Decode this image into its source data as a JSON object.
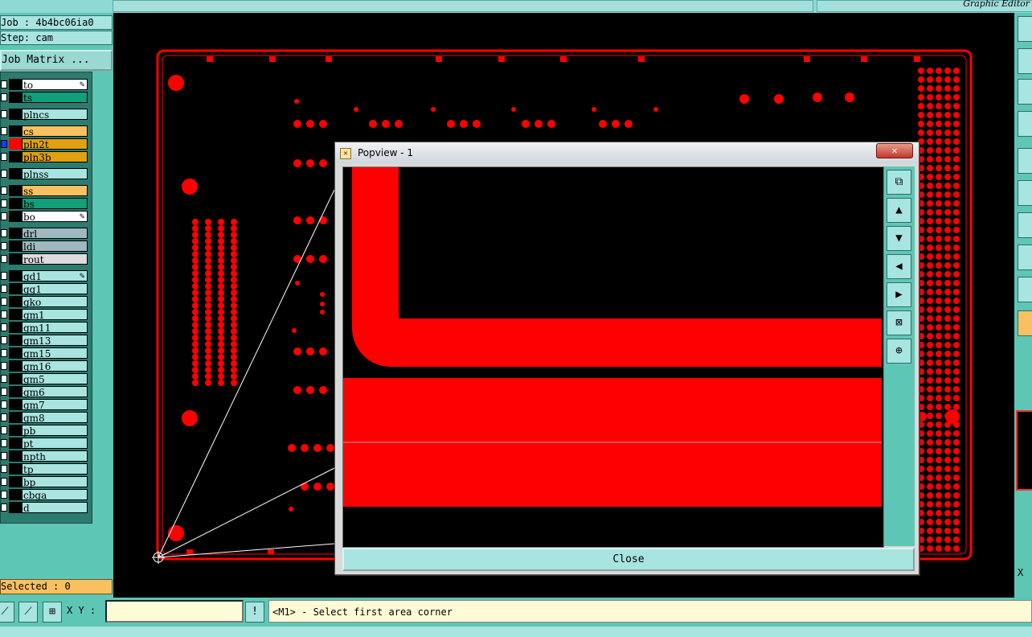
{
  "window_title": "Graphic Editor",
  "job": "Job : 4b4bc06ia0",
  "step": "Step: cam",
  "job_matrix_button": "Job Matrix ...",
  "layers": [
    {
      "name": "to",
      "color": "#ffffff",
      "pen": true
    },
    {
      "name": "ts",
      "color": "#129f7a",
      "pen": false
    },
    {
      "name": "plncs",
      "color": "#a8e4e0",
      "pen": false
    },
    {
      "name": "cs",
      "color": "#f8c060",
      "pen": false
    },
    {
      "name": "pln2t",
      "color": "#e0a010",
      "pen": false,
      "selected": true
    },
    {
      "name": "pln3b",
      "color": "#e0a010",
      "pen": false
    },
    {
      "name": "plnss",
      "color": "#a8e4e0",
      "pen": false
    },
    {
      "name": "ss",
      "color": "#f8c060",
      "pen": false
    },
    {
      "name": "bs",
      "color": "#129f7a",
      "pen": false
    },
    {
      "name": "bo",
      "color": "#ffffff",
      "pen": true
    },
    {
      "name": "drl",
      "color": "#a0b8c0",
      "pen": false
    },
    {
      "name": "ldi",
      "color": "#a0b8c0",
      "pen": false
    },
    {
      "name": "rout",
      "color": "#dcdcdc",
      "pen": false
    },
    {
      "name": "gd1",
      "color": "#a8e4e0",
      "pen": true
    },
    {
      "name": "gg1",
      "color": "#a8e4e0",
      "pen": false
    },
    {
      "name": "gko",
      "color": "#a8e4e0",
      "pen": false
    },
    {
      "name": "gm1",
      "color": "#a8e4e0",
      "pen": false
    },
    {
      "name": "gm11",
      "color": "#a8e4e0",
      "pen": false
    },
    {
      "name": "gm13",
      "color": "#a8e4e0",
      "pen": false
    },
    {
      "name": "gm15",
      "color": "#a8e4e0",
      "pen": false
    },
    {
      "name": "gm16",
      "color": "#a8e4e0",
      "pen": false
    },
    {
      "name": "gm5",
      "color": "#a8e4e0",
      "pen": false
    },
    {
      "name": "gm6",
      "color": "#a8e4e0",
      "pen": false
    },
    {
      "name": "gm7",
      "color": "#a8e4e0",
      "pen": false
    },
    {
      "name": "gm8",
      "color": "#a8e4e0",
      "pen": false
    },
    {
      "name": "pb",
      "color": "#a8e4e0",
      "pen": false
    },
    {
      "name": "pt",
      "color": "#a8e4e0",
      "pen": false
    },
    {
      "name": "npth",
      "color": "#a8e4e0",
      "pen": false
    },
    {
      "name": "tp",
      "color": "#a8e4e0",
      "pen": false
    },
    {
      "name": "bp",
      "color": "#a8e4e0",
      "pen": false
    },
    {
      "name": "cbga",
      "color": "#a8e4e0",
      "pen": false
    },
    {
      "name": "d",
      "color": "#a8e4e0",
      "pen": false
    }
  ],
  "selected_count": "Selected : 0",
  "xy_label": "X Y :",
  "xy_value": "",
  "status_message": "<M1> - Select first area corner",
  "right_x_label": "X",
  "popview": {
    "title": "Popview - 1",
    "close_x": "✕",
    "close_button": "Close"
  },
  "colors": {
    "copper": "#ff0000",
    "panel": "#5ec6b4",
    "widget": "#a8e4e0"
  }
}
